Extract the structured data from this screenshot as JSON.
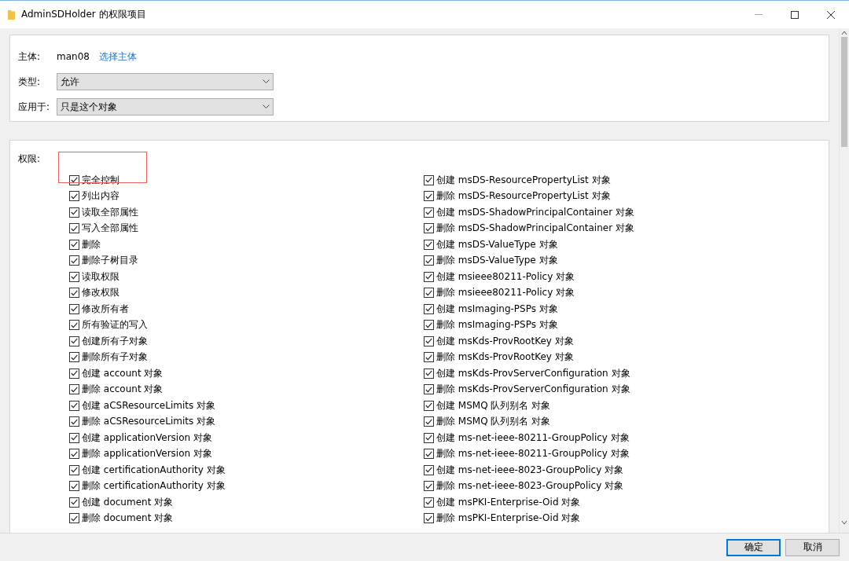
{
  "window": {
    "title": "AdminSDHolder 的权限项目"
  },
  "principal": {
    "label": "主体:",
    "value": "man08",
    "link": "选择主体"
  },
  "type": {
    "label": "类型:",
    "value": "允许"
  },
  "applies_to": {
    "label": "应用于:",
    "value": "只是这个对象"
  },
  "permissions": {
    "label": "权限:",
    "left": [
      {
        "label": "完全控制",
        "checked": true,
        "highlighted": true
      },
      {
        "label": "列出内容",
        "checked": true,
        "highlighted": false
      },
      {
        "label": "读取全部属性",
        "checked": true,
        "highlighted": false
      },
      {
        "label": "写入全部属性",
        "checked": true,
        "highlighted": false
      },
      {
        "label": "删除",
        "checked": true,
        "highlighted": false
      },
      {
        "label": "删除子树目录",
        "checked": true,
        "highlighted": false
      },
      {
        "label": "读取权限",
        "checked": true,
        "highlighted": false
      },
      {
        "label": "修改权限",
        "checked": true,
        "highlighted": false
      },
      {
        "label": "修改所有者",
        "checked": true,
        "highlighted": false
      },
      {
        "label": "所有验证的写入",
        "checked": true,
        "highlighted": false
      },
      {
        "label": "创建所有子对象",
        "checked": true,
        "highlighted": false
      },
      {
        "label": "删除所有子对象",
        "checked": true,
        "highlighted": false
      },
      {
        "label": "创建 account 对象",
        "checked": true,
        "highlighted": false
      },
      {
        "label": "删除 account 对象",
        "checked": true,
        "highlighted": false
      },
      {
        "label": "创建 aCSResourceLimits 对象",
        "checked": true,
        "highlighted": false
      },
      {
        "label": "删除 aCSResourceLimits 对象",
        "checked": true,
        "highlighted": false
      },
      {
        "label": "创建 applicationVersion 对象",
        "checked": true,
        "highlighted": false
      },
      {
        "label": "删除 applicationVersion 对象",
        "checked": true,
        "highlighted": false
      },
      {
        "label": "创建 certificationAuthority 对象",
        "checked": true,
        "highlighted": false
      },
      {
        "label": "删除 certificationAuthority 对象",
        "checked": true,
        "highlighted": false
      },
      {
        "label": "创建 document 对象",
        "checked": true,
        "highlighted": false
      },
      {
        "label": "删除 document 对象",
        "checked": true,
        "highlighted": false
      }
    ],
    "right": [
      {
        "label": "创建 msDS-ResourcePropertyList 对象",
        "checked": true,
        "highlighted": false
      },
      {
        "label": "删除 msDS-ResourcePropertyList 对象",
        "checked": true,
        "highlighted": false
      },
      {
        "label": "创建 msDS-ShadowPrincipalContainer 对象",
        "checked": true,
        "highlighted": false
      },
      {
        "label": "删除 msDS-ShadowPrincipalContainer 对象",
        "checked": true,
        "highlighted": false
      },
      {
        "label": "创建 msDS-ValueType 对象",
        "checked": true,
        "highlighted": false
      },
      {
        "label": "删除 msDS-ValueType 对象",
        "checked": true,
        "highlighted": false
      },
      {
        "label": "创建 msieee80211-Policy 对象",
        "checked": true,
        "highlighted": false
      },
      {
        "label": "删除 msieee80211-Policy 对象",
        "checked": true,
        "highlighted": false
      },
      {
        "label": "创建 msImaging-PSPs 对象",
        "checked": true,
        "highlighted": false
      },
      {
        "label": "删除 msImaging-PSPs 对象",
        "checked": true,
        "highlighted": false
      },
      {
        "label": "创建 msKds-ProvRootKey 对象",
        "checked": true,
        "highlighted": false
      },
      {
        "label": "删除 msKds-ProvRootKey 对象",
        "checked": true,
        "highlighted": false
      },
      {
        "label": "创建 msKds-ProvServerConfiguration 对象",
        "checked": true,
        "highlighted": false
      },
      {
        "label": "删除 msKds-ProvServerConfiguration 对象",
        "checked": true,
        "highlighted": false
      },
      {
        "label": "创建 MSMQ 队列别名 对象",
        "checked": true,
        "highlighted": false
      },
      {
        "label": "删除 MSMQ 队列别名 对象",
        "checked": true,
        "highlighted": false
      },
      {
        "label": "创建 ms-net-ieee-80211-GroupPolicy 对象",
        "checked": true,
        "highlighted": false
      },
      {
        "label": "删除 ms-net-ieee-80211-GroupPolicy 对象",
        "checked": true,
        "highlighted": false
      },
      {
        "label": "创建 ms-net-ieee-8023-GroupPolicy 对象",
        "checked": true,
        "highlighted": false
      },
      {
        "label": "删除 ms-net-ieee-8023-GroupPolicy 对象",
        "checked": true,
        "highlighted": false
      },
      {
        "label": "创建 msPKI-Enterprise-Oid 对象",
        "checked": true,
        "highlighted": false
      },
      {
        "label": "删除 msPKI-Enterprise-Oid 对象",
        "checked": true,
        "highlighted": false
      }
    ]
  },
  "buttons": [
    {
      "label": "确定",
      "default": true
    },
    {
      "label": "取消",
      "default": false
    }
  ]
}
